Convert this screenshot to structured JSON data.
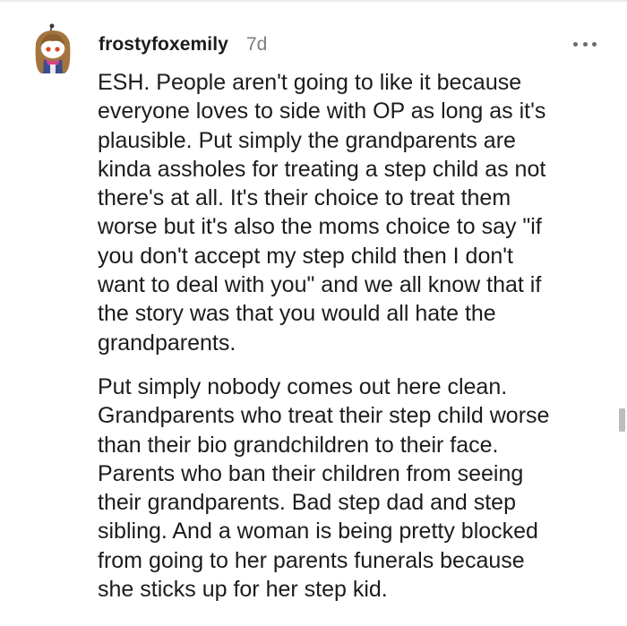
{
  "comment": {
    "author": "frostyfoxemily",
    "age": "7d",
    "avatar_icon": "snoo-avatar-icon",
    "more_icon": "more-options-icon",
    "paragraphs": [
      "ESH. People aren't going to like it because\neveryone loves to side with OP as long as it's\nplausible. Put simply the grandparents are\nkinda assholes for treating a step child as not\nthere's at all. It's their choice to treat them\nworse but it's also the moms choice to say \"if\nyou don't accept my step child then I don't\nwant to deal with you\" and we all know that if\nthe story was that you would all hate the\ngrandparents.",
      "Put simply nobody comes out here clean.\nGrandparents who treat their step child worse\nthan their bio grandchildren to their face.\nParents who ban their children from seeing\ntheir grandparents. Bad step dad and step\nsibling. And a woman is being pretty blocked\nfrom going to her parents funerals because\nshe sticks up for her step kid."
    ]
  },
  "colors": {
    "text": "#1c1c1c",
    "meta": "#7c7c7c",
    "avatar_hair": "#a4743e",
    "avatar_scarf": "#d9408a",
    "scrollbar": "#bdbdbd"
  }
}
